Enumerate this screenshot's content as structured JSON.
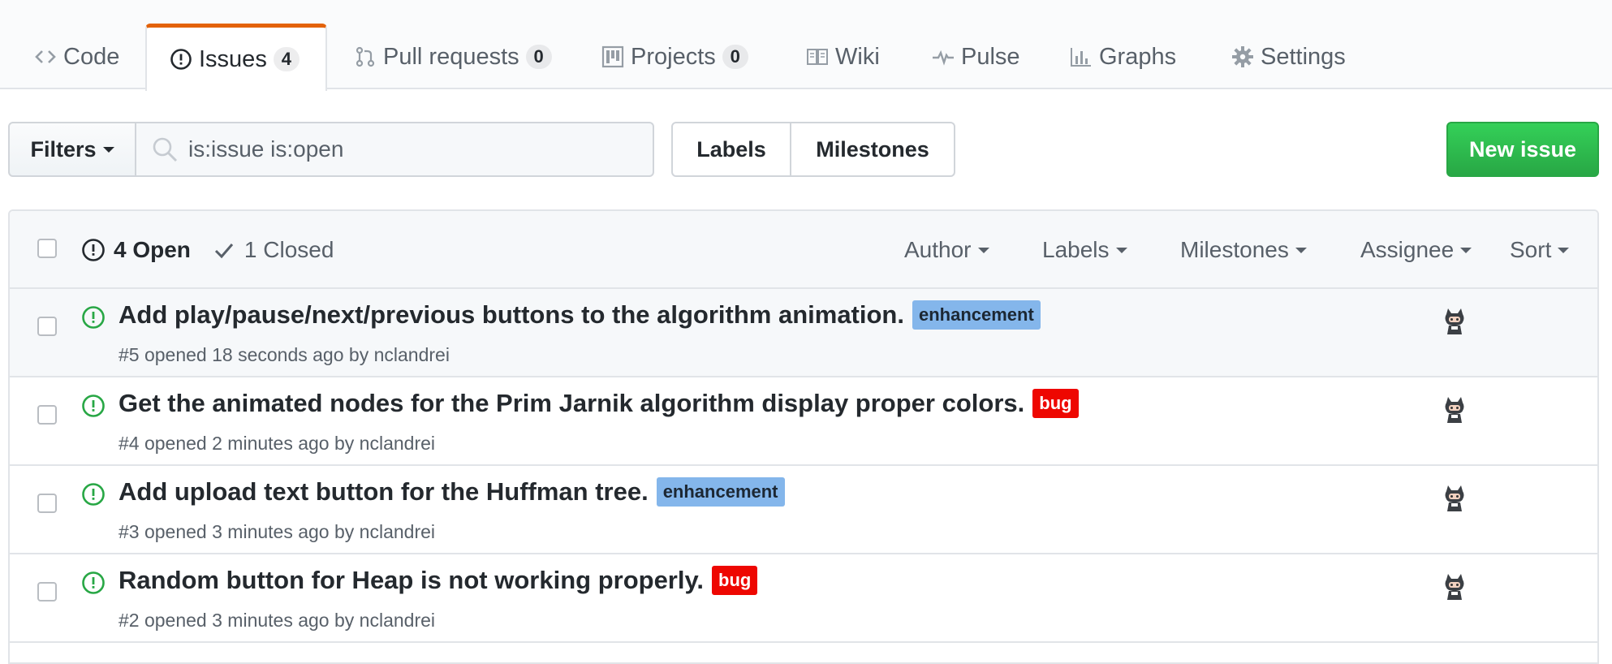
{
  "nav": {
    "tabs": [
      {
        "label": "Code",
        "icon": "code-icon"
      },
      {
        "label": "Issues",
        "count": "4",
        "icon": "issue-opened-icon",
        "selected": true
      },
      {
        "label": "Pull requests",
        "count": "0",
        "icon": "git-pull-request-icon"
      },
      {
        "label": "Projects",
        "count": "0",
        "icon": "project-icon"
      },
      {
        "label": "Wiki",
        "icon": "book-icon"
      },
      {
        "label": "Pulse",
        "icon": "pulse-icon"
      },
      {
        "label": "Graphs",
        "icon": "graph-icon"
      },
      {
        "label": "Settings",
        "icon": "gear-icon"
      }
    ]
  },
  "subnav": {
    "filters_label": "Filters",
    "search_value": "is:issue is:open",
    "labels_label": "Labels",
    "milestones_label": "Milestones",
    "new_issue_label": "New issue"
  },
  "issues_header": {
    "open_label": "4 Open",
    "closed_label": "1 Closed",
    "filters": [
      "Author",
      "Labels",
      "Milestones",
      "Assignee",
      "Sort"
    ]
  },
  "issues": [
    {
      "title": "Add play/pause/next/previous buttons to the algorithm animation.",
      "label": "enhancement",
      "meta": "#5 opened 18 seconds ago by nclandrei"
    },
    {
      "title": "Get the animated nodes for the Prim Jarnik algorithm display proper colors.",
      "label": "bug",
      "meta": "#4 opened 2 minutes ago by nclandrei"
    },
    {
      "title": "Add upload text button for the Huffman tree.",
      "label": "enhancement",
      "meta": "#3 opened 3 minutes ago by nclandrei"
    },
    {
      "title": "Random button for Heap is not working properly.",
      "label": "bug",
      "meta": "#2 opened 3 minutes ago by nclandrei"
    }
  ],
  "colors": {
    "accent_tab": "#e36209",
    "open_green": "#28a745",
    "enhancement": "#84b6eb",
    "bug": "#ee0701"
  }
}
